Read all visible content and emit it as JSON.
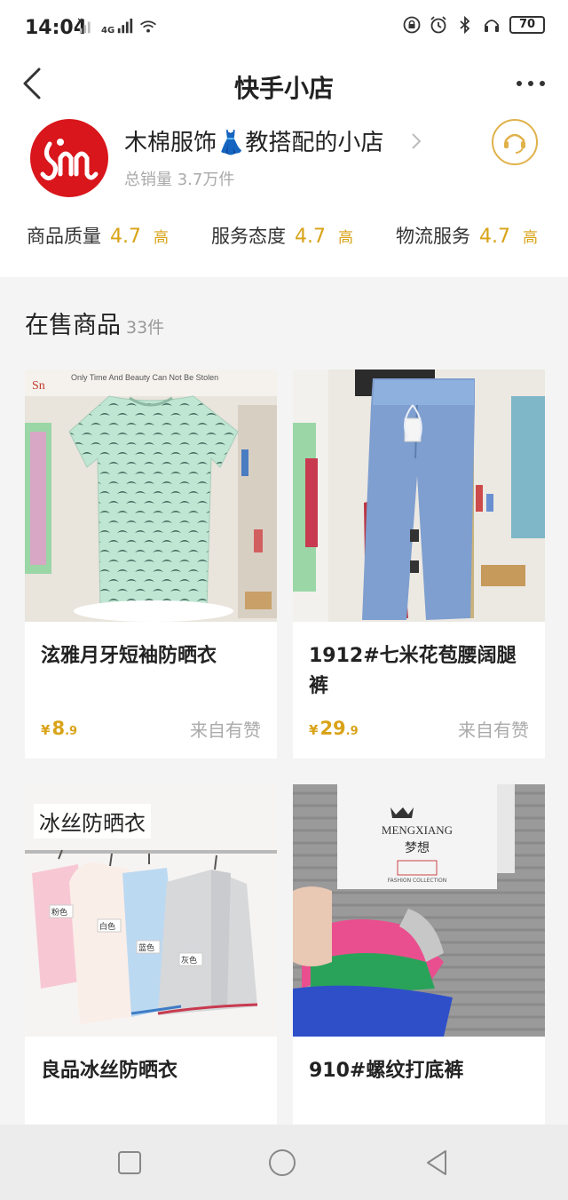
{
  "status_bar": {
    "time": "14:04",
    "network_label": "4G",
    "battery": "70",
    "icons": [
      "signal-x-icon",
      "signal-icon",
      "wifi-icon",
      "lock-icon",
      "alarm-icon",
      "bluetooth-icon",
      "headphones-icon",
      "battery-icon"
    ]
  },
  "header": {
    "title": "快手小店",
    "back_icon": "chevron-left-icon",
    "more_icon": "more-icon"
  },
  "shop": {
    "name": "木棉服饰👗教搭配的小店",
    "sales": "总销量 3.7万件",
    "service_icon": "customer-service-icon",
    "ratings": [
      {
        "label": "商品质量",
        "score": "4.7",
        "level": "高"
      },
      {
        "label": "服务态度",
        "score": "4.7",
        "level": "高"
      },
      {
        "label": "物流服务",
        "score": "4.7",
        "level": "高"
      }
    ]
  },
  "section": {
    "title": "在售商品",
    "count": "33件"
  },
  "products": [
    {
      "title": "泫雅月牙短袖防晒衣",
      "price_symbol": "¥",
      "price_int": "8",
      "price_dec": ".9",
      "source": "来自有赞",
      "image_text": "Only Time And Beauty Can Not Be Stolen"
    },
    {
      "title": "1912#七米花苞腰阔腿裤",
      "price_symbol": "¥",
      "price_int": "29",
      "price_dec": ".9",
      "source": "来自有赞"
    },
    {
      "title": "良品冰丝防晒衣",
      "image_label": "冰丝防晒衣",
      "color_tags": [
        "粉色",
        "白色",
        "蓝色",
        "灰色"
      ]
    },
    {
      "title": "910#螺纹打底裤",
      "tag_brand": "MENGXIANG",
      "tag_cn": "梦想",
      "tag_small": "FASHION COLLECTION"
    }
  ],
  "colors": {
    "accent": "#d9a318",
    "logo_red": "#d8161b"
  },
  "nav": {
    "icons": [
      "square-icon",
      "circle-icon",
      "triangle-back-icon"
    ]
  }
}
